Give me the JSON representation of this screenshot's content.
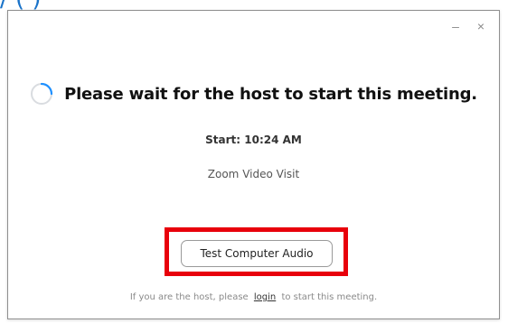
{
  "background": {
    "caption": "/  (                                        )"
  },
  "window": {
    "controls": {
      "minimize": "–",
      "close": "×"
    },
    "headline": "Please wait for the host to start this meeting.",
    "spinner_icon": "loading-spinner-icon",
    "start_time": "Start: 10:24 AM",
    "meeting_name": "Zoom Video Visit",
    "test_audio_button": "Test Computer Audio",
    "footer": {
      "prefix": "If you are the host, please",
      "link": "login",
      "suffix": "to start this meeting."
    }
  },
  "colors": {
    "highlight": "#e8000b",
    "spinner": "#1e90ff",
    "caption": "#1a73c9"
  }
}
